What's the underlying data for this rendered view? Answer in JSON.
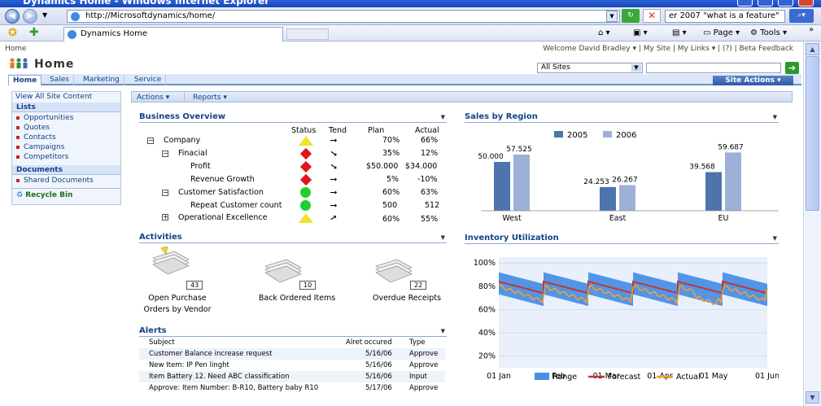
{
  "browser": {
    "window_title": "Dynamics Home - Windows Internet Explorer",
    "url": "http://Microsoftdynamics/home/",
    "search_value": "er 2007 \"what is a feature\"",
    "tab_label": "Dynamics Home",
    "commands": {
      "page": "Page",
      "tools": "Tools"
    }
  },
  "site": {
    "breadcrumb": "Home",
    "welcome": "Welcome David Bradley ▾ | My Site | My Links ▾ | (?) | Beta Feedback",
    "title": "Home",
    "scope_select": "All Sites",
    "site_actions": "Site Actions ▾",
    "tabs": [
      "Home",
      "Sales",
      "Marketing",
      "Service"
    ]
  },
  "quicklaunch": {
    "view_all": "View All Site Content",
    "lists_header": "Lists",
    "lists": [
      "Opportunities",
      "Quotes",
      "Contacts",
      "Campaigns",
      "Competitors"
    ],
    "documents_header": "Documents",
    "documents": [
      "Shared Documents"
    ],
    "recycle": "Recycle Bin"
  },
  "toolbar": {
    "actions": "Actions ▾",
    "reports": "Reports ▾"
  },
  "business_overview": {
    "title": "Business Overview",
    "columns": {
      "status": "Status",
      "trend": "Tend",
      "plan": "Plan",
      "actual": "Actual"
    },
    "rows": [
      {
        "label": "Company",
        "status": "yellow-triangle",
        "trend": "flat",
        "plan": "70%",
        "actual": "66%"
      },
      {
        "label": "Finacial",
        "status": "red-diamond",
        "trend": "down",
        "plan": "35%",
        "actual": "12%"
      },
      {
        "label": "Profit",
        "status": "red-diamond",
        "trend": "down",
        "plan": "$50.000",
        "actual": "$34.000"
      },
      {
        "label": "Revenue Growth",
        "status": "red-diamond",
        "trend": "flat",
        "plan": "5%",
        "actual": "-10%"
      },
      {
        "label": "Customer Satisfaction",
        "status": "green-circle",
        "trend": "flat",
        "plan": "60%",
        "actual": "63%"
      },
      {
        "label": "Repeat Customer count",
        "status": "green-circle",
        "trend": "flat",
        "plan": "500",
        "actual": "512"
      },
      {
        "label": "Operational Excellence",
        "status": "yellow-triangle",
        "trend": "up",
        "plan": "60%",
        "actual": "55%"
      }
    ]
  },
  "activities": {
    "title": "Activities",
    "items": [
      {
        "label_line1": "Open Purchase",
        "label_line2": "Orders by Vendor",
        "count": "43",
        "warning": true
      },
      {
        "label_line1": "Back Ordered Items",
        "label_line2": "",
        "count": "10",
        "warning": false
      },
      {
        "label_line1": "Overdue Receipts",
        "label_line2": "",
        "count": "22",
        "warning": false
      }
    ]
  },
  "alerts": {
    "title": "Alerts",
    "columns": {
      "subject": "Subject",
      "date": "Alret occured",
      "type": "Type"
    },
    "rows": [
      {
        "subject": "Customer Balance increase request",
        "date": "5/16/06",
        "type": "Approve"
      },
      {
        "subject": "New Item: IP Pen linght",
        "date": "5/16/06",
        "type": "Approve"
      },
      {
        "subject": "Item Battery 12. Need ABC classification",
        "date": "5/16/06",
        "type": "Input"
      },
      {
        "subject": "Approve: Item Number: B-R10, Battery baby R10",
        "date": "5/17/06",
        "type": "Approve"
      }
    ]
  },
  "chart_data": [
    {
      "type": "bar",
      "title": "Sales by Region",
      "categories": [
        "West",
        "East",
        "EU"
      ],
      "series": [
        {
          "name": "2005",
          "values": [
            50.0,
            24.253,
            39.568
          ],
          "labels": [
            "50.000",
            "24.253",
            "39.568"
          ],
          "color": "#4d74ad"
        },
        {
          "name": "2006",
          "values": [
            57.525,
            26.267,
            59.687
          ],
          "labels": [
            "57.525",
            "26.267",
            "59.687"
          ],
          "color": "#9fb0d8"
        }
      ],
      "ylim": [
        0,
        70
      ],
      "legend": "top-center"
    },
    {
      "type": "line",
      "title": "Inventory Utilization",
      "x_labels": [
        "01 Jan",
        "01 Feb",
        "01 Mar",
        "01 Apr",
        "01 May",
        "01 Jun"
      ],
      "y_ticks": [
        "20%",
        "40%",
        "60%",
        "80%",
        "100%"
      ],
      "ylim": [
        10,
        105
      ],
      "series": [
        {
          "name": "Range",
          "type": "area",
          "color": "#4a8fe6"
        },
        {
          "name": "Forecast",
          "type": "line",
          "color": "#c0392b"
        },
        {
          "name": "Actual",
          "type": "line",
          "color": "#f0a030"
        }
      ],
      "legend": "bottom-center"
    }
  ]
}
